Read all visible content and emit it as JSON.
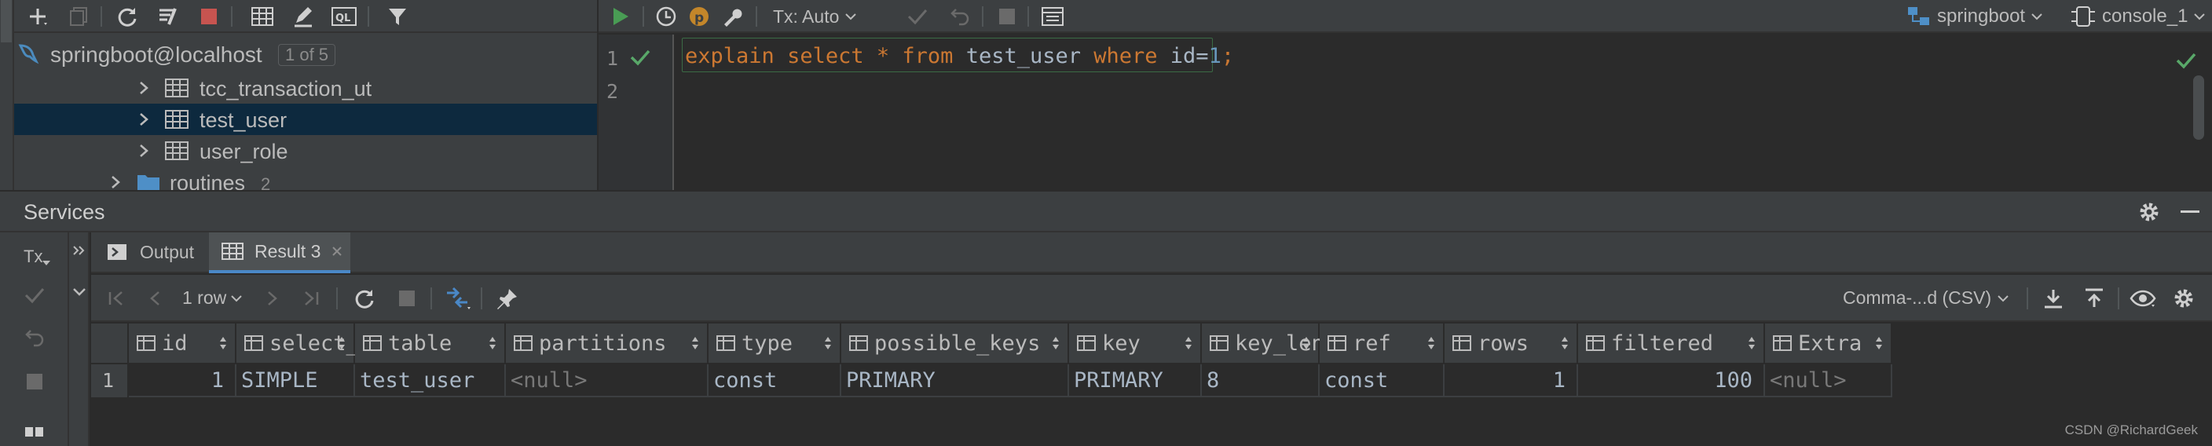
{
  "datasource": {
    "name": "springboot@localhost",
    "count_badge": "1 of 5"
  },
  "tree": {
    "items": [
      {
        "label": "tcc_transaction_ut",
        "kind": "table"
      },
      {
        "label": "test_user",
        "kind": "table",
        "selected": true
      },
      {
        "label": "user_role",
        "kind": "table"
      },
      {
        "label": "routines",
        "kind": "folder",
        "count": "2"
      }
    ]
  },
  "editor_toolbar": {
    "tx_label": "Tx: Auto",
    "schema": "springboot",
    "console": "console_1"
  },
  "editor": {
    "lines": [
      {
        "number": "1",
        "tokens": [
          {
            "text": "explain",
            "type": "kw"
          },
          {
            "text": " ",
            "type": "plain"
          },
          {
            "text": "select",
            "type": "kw"
          },
          {
            "text": " ",
            "type": "plain"
          },
          {
            "text": "*",
            "type": "kw"
          },
          {
            "text": " ",
            "type": "plain"
          },
          {
            "text": "from",
            "type": "kw"
          },
          {
            "text": " test_user ",
            "type": "plain"
          },
          {
            "text": "where",
            "type": "kw"
          },
          {
            "text": " id=",
            "type": "plain"
          },
          {
            "text": "1",
            "type": "num"
          },
          {
            "text": ";",
            "type": "kw"
          }
        ]
      },
      {
        "number": "2",
        "tokens": []
      }
    ]
  },
  "services": {
    "title": "Services",
    "tx_label": "Tx",
    "tabs": [
      {
        "label": "Output",
        "active": false
      },
      {
        "label": "Result 3",
        "active": true
      }
    ]
  },
  "result_toolbar": {
    "rows_label": "1 row",
    "export_format": "Comma-...d (CSV)"
  },
  "grid": {
    "columns": [
      "id",
      "select_type",
      "table",
      "partitions",
      "type",
      "possible_keys",
      "key",
      "key_len",
      "ref",
      "rows",
      "filtered",
      "Extra"
    ],
    "rows": [
      {
        "row_number": "1",
        "cells": [
          "1",
          "SIMPLE",
          "test_user",
          "<null>",
          "const",
          "PRIMARY",
          "PRIMARY",
          "8",
          "const",
          "1",
          "100",
          "<null>"
        ]
      }
    ]
  },
  "watermark": "CSDN @RichardGeek",
  "colors": {
    "keyword": "#cc7832",
    "number": "#6897bb",
    "identifier": "#a9b7c6",
    "check": "#59a869",
    "selection": "#0d293e",
    "run": "#499c54",
    "stop": "#c75450"
  }
}
